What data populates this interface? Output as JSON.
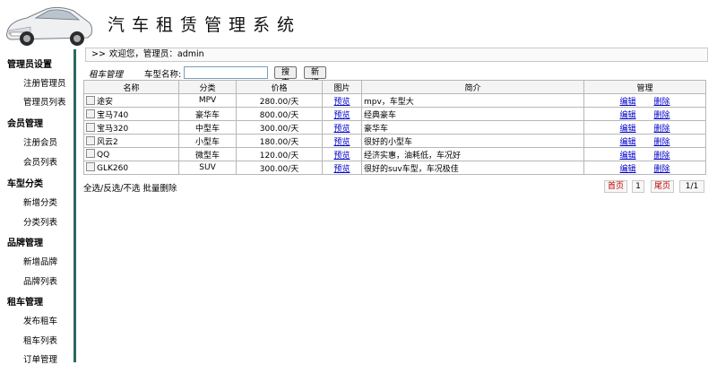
{
  "header": {
    "title": "汽车租赁管理系统"
  },
  "welcome": {
    "arrows": ">>",
    "text": "欢迎您，管理员：admin"
  },
  "sidebar": {
    "groups": [
      {
        "title": "管理员设置",
        "items": [
          "注册管理员",
          "管理员列表"
        ]
      },
      {
        "title": "会员管理",
        "items": [
          "注册会员",
          "会员列表"
        ]
      },
      {
        "title": "车型分类",
        "items": [
          "新增分类",
          "分类列表"
        ]
      },
      {
        "title": "品牌管理",
        "items": [
          "新增品牌",
          "品牌列表"
        ]
      },
      {
        "title": "租车管理",
        "items": [
          "发布租车",
          "租车列表",
          "订单管理"
        ]
      }
    ]
  },
  "toolbar": {
    "section_label": "租车管理",
    "search_label": "车型名称:",
    "search_value": "",
    "search_button": "搜索",
    "add_button": "新增"
  },
  "table": {
    "headers": [
      "名称",
      "分类",
      "价格",
      "图片",
      "简介",
      "管理"
    ],
    "rows": [
      {
        "name": "途安",
        "category": "MPV",
        "price": "280.00/天",
        "image": "预览",
        "intro": "mpv，车型大",
        "edit": "编辑",
        "delete": "删除"
      },
      {
        "name": "宝马740",
        "category": "豪华车",
        "price": "800.00/天",
        "image": "预览",
        "intro": "经典豪车",
        "edit": "编辑",
        "delete": "删除"
      },
      {
        "name": "宝马320",
        "category": "中型车",
        "price": "300.00/天",
        "image": "预览",
        "intro": "豪华车",
        "edit": "编辑",
        "delete": "删除"
      },
      {
        "name": "风云2",
        "category": "小型车",
        "price": "180.00/天",
        "image": "预览",
        "intro": "很好的小型车",
        "edit": "编辑",
        "delete": "删除"
      },
      {
        "name": "QQ",
        "category": "微型车",
        "price": "120.00/天",
        "image": "预览",
        "intro": "经济实惠，油耗低，车况好",
        "edit": "编辑",
        "delete": "删除"
      },
      {
        "name": "GLK260",
        "category": "SUV",
        "price": "300.00/天",
        "image": "预览",
        "intro": "很好的suv车型，车况极佳",
        "edit": "编辑",
        "delete": "删除"
      }
    ]
  },
  "footer": {
    "bulk_actions": "全选/反选/不选  批量删除",
    "first_page": "首页",
    "current_page": "1",
    "last_page": "尾页",
    "page_total": "1/1"
  },
  "colors": {
    "sidebar_divider": "#2a6a62",
    "link": "#0000cc",
    "pager_text": "#c00000"
  }
}
